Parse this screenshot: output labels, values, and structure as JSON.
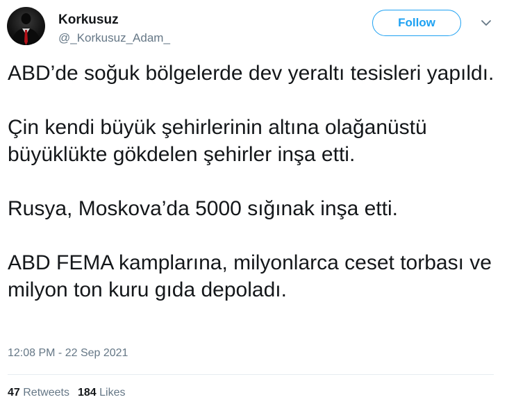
{
  "author": {
    "display_name": "Korkusuz",
    "handle": "@_Korkusuz_Adam_"
  },
  "follow_button": {
    "label": "Follow"
  },
  "icons": {
    "avatar": "avatar-suit-figure",
    "menu": "chevron-down-icon"
  },
  "tweet": {
    "paragraphs": [
      "ABD’de soğuk bölgelerde dev yeraltı tesisleri yapıldı.",
      "Çin kendi büyük şehirlerinin altına olağanüstü büyüklükte gökdelen şehirler inşa etti.",
      "Rusya, Moskova’da 5000 sığınak inşa etti.",
      "ABD FEMA kamplarına, milyonlarca ceset torbası ve milyon ton kuru gıda depoladı."
    ],
    "timestamp": "12:08 PM - 22 Sep 2021"
  },
  "stats": {
    "retweets_count": "47",
    "retweets_label": "Retweets",
    "likes_count": "184",
    "likes_label": "Likes"
  },
  "colors": {
    "accent": "#1da1f2",
    "text": "#14171a",
    "muted": "#657786",
    "divider": "#e6ecf0"
  }
}
